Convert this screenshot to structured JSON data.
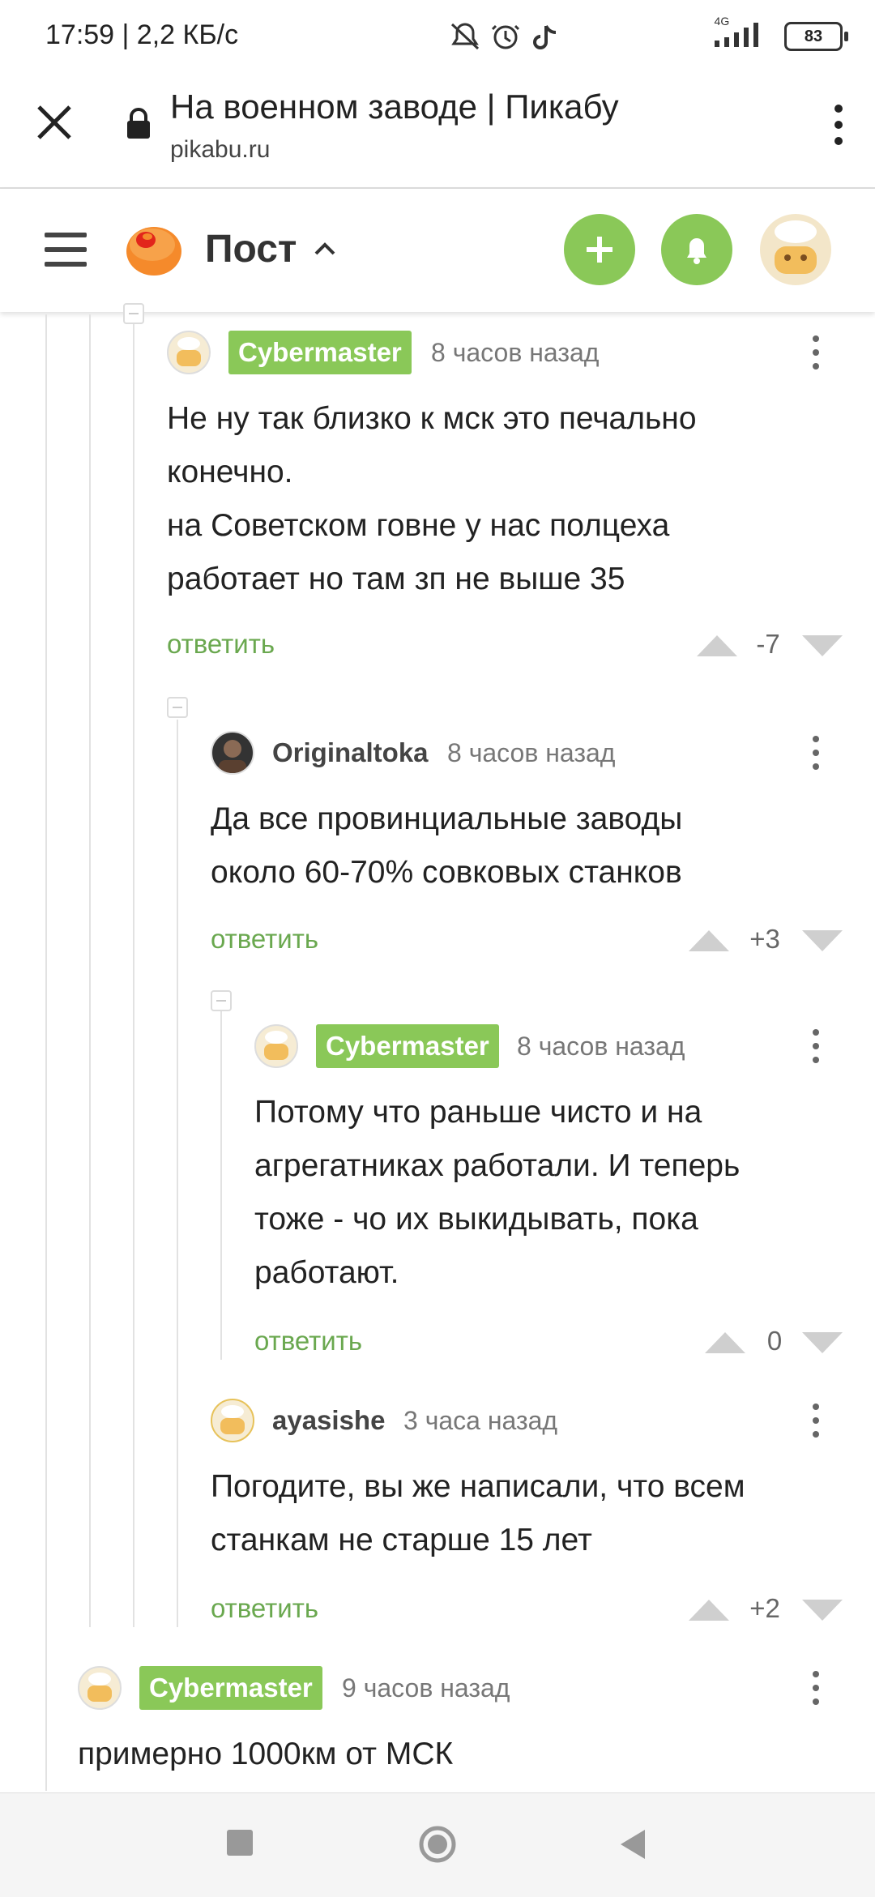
{
  "status": {
    "time": "17:59 | 2,2 КБ/с",
    "network": "4G",
    "battery": "83"
  },
  "browser": {
    "title": "На военном заводе | Пикабу",
    "url": "pikabu.ru"
  },
  "header": {
    "title": "Пост"
  },
  "comments": [
    {
      "author": "Cybermaster",
      "time": "8 часов назад",
      "text": "Не ну так близко к мск это печально конечно.\nна Советском говне у нас полцеха работает но там зп не выше 35",
      "reply": "ответить",
      "rating": "-7"
    },
    {
      "author": "Originaltoka",
      "time": "8 часов назад",
      "text": "Да все провинциальные заводы около 60-70% совковых станков",
      "reply": "ответить",
      "rating": "+3"
    },
    {
      "author": "Cybermaster",
      "time": "8 часов назад",
      "text": "Потому что раньше чисто и на агрегатниках работали. И теперь тоже - чо их выкидывать, пока работают.",
      "reply": "ответить",
      "rating": "0"
    },
    {
      "author": "ayasishe",
      "time": "3 часа назад",
      "text": "Погодите, вы же написали, что всем станкам не старше 15 лет",
      "reply": "ответить",
      "rating": "+2"
    },
    {
      "author": "Cybermaster",
      "time": "9 часов назад",
      "text": "примерно 1000км от МСК"
    }
  ],
  "colors": {
    "accent": "#8ac858",
    "reply": "#6aa84f"
  }
}
